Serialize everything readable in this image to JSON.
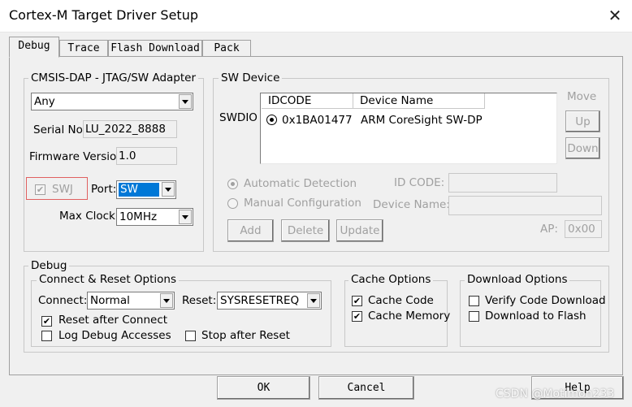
{
  "window": {
    "title": "Cortex-M Target Driver Setup",
    "close": "✕"
  },
  "tabs": [
    "Debug",
    "Trace",
    "Flash Download",
    "Pack"
  ],
  "adapter": {
    "group": "CMSIS-DAP - JTAG/SW Adapter",
    "selected": "Any",
    "serial_label": "Serial No:",
    "serial": "LU_2022_8888",
    "firmware_label": "Firmware Version:",
    "firmware": "1.0",
    "swj_label": "SWJ",
    "swj_checked": true,
    "port_label": "Port:",
    "port": "SW",
    "clock_label": "Max Clock:",
    "clock": "10MHz"
  },
  "sw_device": {
    "group": "SW Device",
    "row_label": "SWDIO",
    "col_idcode": "IDCODE",
    "col_name": "Device Name",
    "row_idcode": "0x1BA01477",
    "row_name": "ARM CoreSight SW-DP",
    "move_label": "Move",
    "up": "Up",
    "down": "Down",
    "auto": "Automatic Detection",
    "manual": "Manual Configuration",
    "id_code_label": "ID CODE:",
    "device_name_label": "Device Name:",
    "add": "Add",
    "delete": "Delete",
    "update": "Update",
    "ap_label": "AP:",
    "ap": "0x00"
  },
  "debug": {
    "group": "Debug",
    "connect_group": "Connect & Reset Options",
    "connect_label": "Connect:",
    "connect": "Normal",
    "reset_label": "Reset:",
    "reset": "SYSRESETREQ",
    "reset_after_connect": "Reset after Connect",
    "log_debug": "Log Debug Accesses",
    "stop_after_reset": "Stop after Reset",
    "cache_group": "Cache Options",
    "cache_code": "Cache Code",
    "cache_memory": "Cache Memory",
    "download_group": "Download Options",
    "verify_code": "Verify Code Download",
    "download_flash": "Download to Flash"
  },
  "buttons": {
    "ok": "OK",
    "cancel": "Cancel",
    "help": "Help"
  },
  "watermark": "CSDN @Motimon233",
  "colors": {
    "swj_highlight": "#e06060",
    "selection": "#0078d7"
  }
}
